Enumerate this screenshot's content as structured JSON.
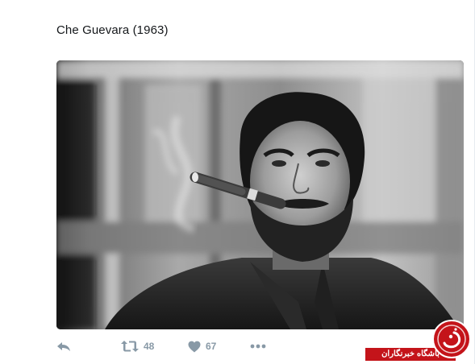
{
  "tweet": {
    "text": "Che Guevara (1963)",
    "image_alt": "Black-and-white portrait of a bearded man in a beret-less hairstyle smoking a cigar"
  },
  "actions": {
    "reply_icon": "reply-icon",
    "retweet_icon": "retweet-icon",
    "retweet_count": "48",
    "like_icon": "heart-icon",
    "like_count": "67",
    "more_icon": "more-dots-icon"
  },
  "watermark": {
    "text": "باشگاه خبرنگاران",
    "seal_icon": "logo-seal",
    "color": "#c4141a"
  },
  "colors": {
    "text": "#14171a",
    "muted": "#8899a6",
    "border": "#e6ecf0"
  }
}
